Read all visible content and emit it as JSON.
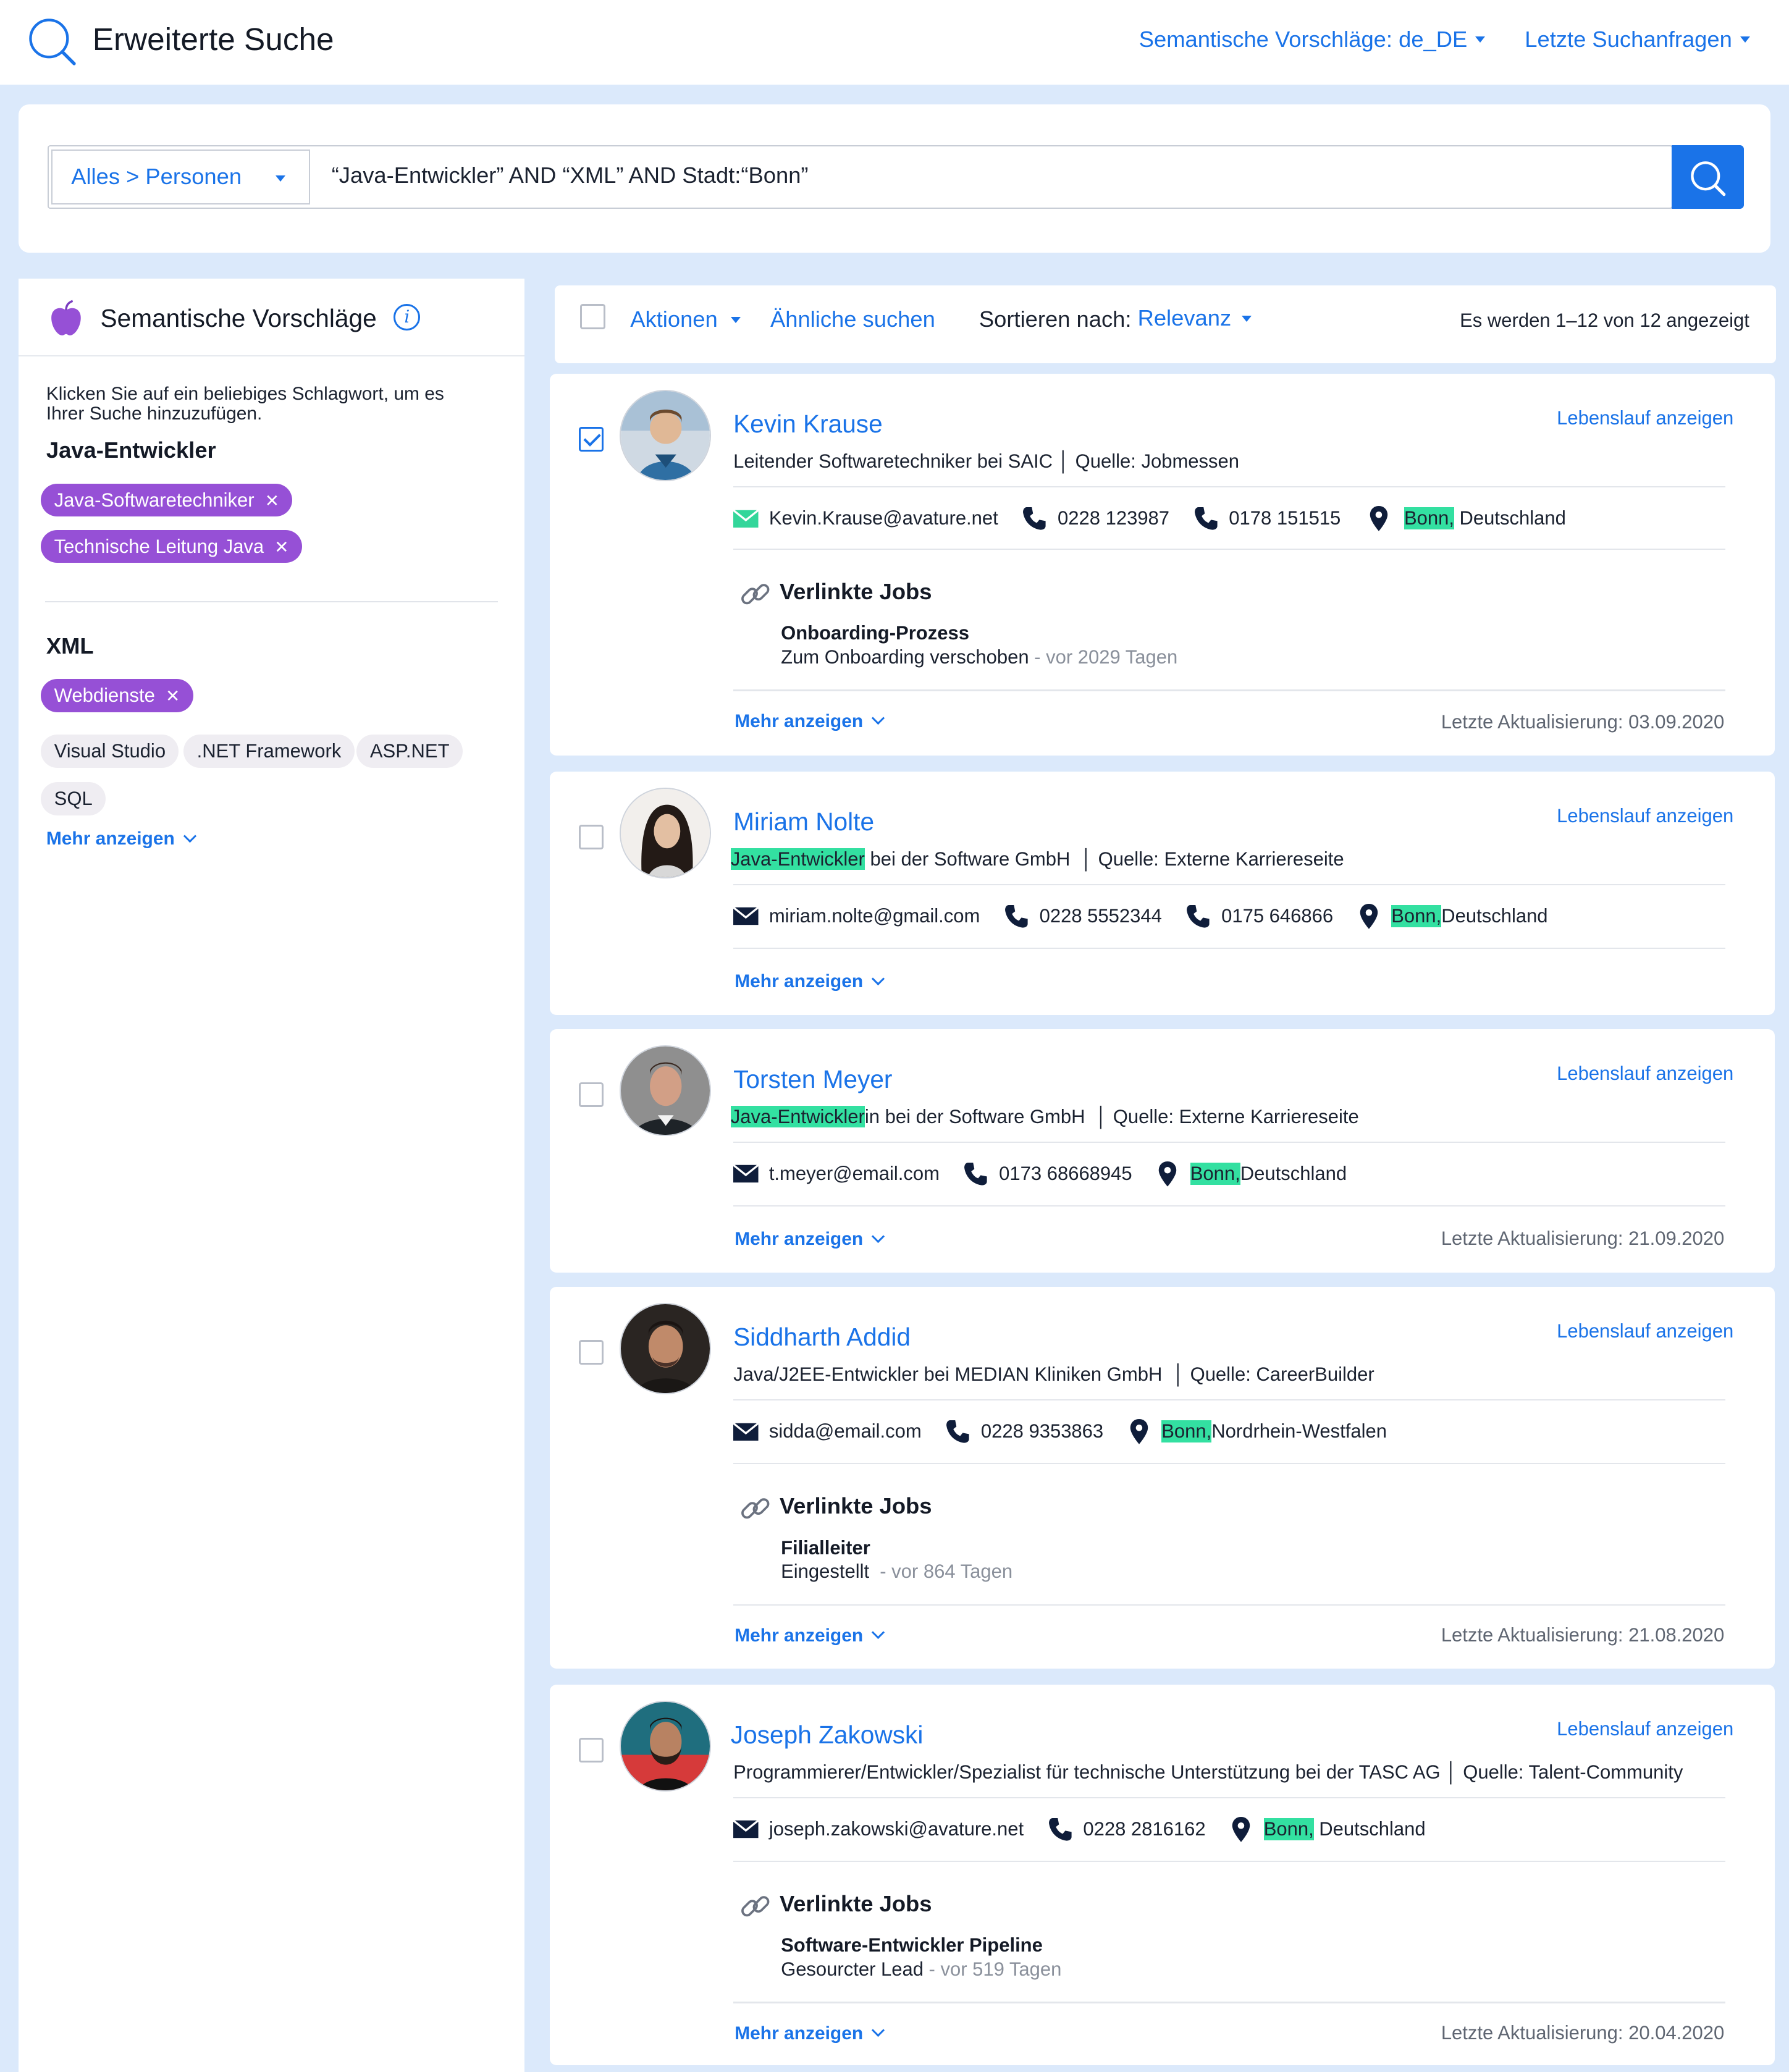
{
  "header": {
    "title": "Erweiterte Suche",
    "suggest_menu": "Semantische Vorschläge: de_DE",
    "recent_menu": "Letzte Suchanfragen"
  },
  "search": {
    "scope": "Alles > Personen",
    "query": "“Java-Entwickler” AND “XML” AND Stadt:“Bonn”"
  },
  "sidebar": {
    "title": "Semantische Vorschläge",
    "hint": "Klicken Sie auf ein beliebiges Schlagwort, um es Ihrer Suche hinzuzufügen.",
    "groups": [
      {
        "title": "Java-Entwickler",
        "selected": [
          "Java-Softwaretechniker",
          "Technische Leitung Java"
        ]
      },
      {
        "title": "XML",
        "selected": [
          "Webdienste"
        ],
        "suggestions": [
          "Visual Studio",
          ".NET Framework",
          "ASP.NET",
          "SQL"
        ]
      }
    ],
    "more": "Mehr anzeigen"
  },
  "toolbar": {
    "actions": "Aktionen",
    "similar": "Ähnliche suchen",
    "sort_label": "Sortieren nach:",
    "sort_value": "Relevanz",
    "count": "Es werden 1–12 von 12 angezeigt"
  },
  "common": {
    "cv_link": "Lebenslauf anzeigen",
    "more": "Mehr anzeigen",
    "linked_jobs": "Verlinkte Jobs"
  },
  "results": [
    {
      "name": "Kevin Krause",
      "checked": true,
      "headline": "Leitender Softwaretechniker bei SAIC",
      "source": "Quelle: Jobmessen",
      "email": "Kevin.Krause@avature.net",
      "phones": [
        "0228 123987",
        "0178 151515"
      ],
      "city": "Bonn,",
      "region": "Deutschland",
      "job": {
        "name": "Onboarding-Prozess",
        "status": "Zum Onboarding verschoben",
        "age": "- vor 2029 Tagen"
      },
      "updated": "Letzte Aktualisierung: 03.09.2020"
    },
    {
      "name": "Miriam Nolte",
      "checked": false,
      "headline_hl": "Java-Entwickler",
      "headline_rest": " bei der Software GmbH",
      "source": "Quelle: Externe Karriereseite",
      "email": "miriam.nolte@gmail.com",
      "phones": [
        "0228 5552344",
        "0175 646866"
      ],
      "city": "Bonn,",
      "region": "Deutschland"
    },
    {
      "name": "Torsten Meyer",
      "checked": false,
      "headline_hl": "Java-Entwickler",
      "headline_rest": "in bei der Software GmbH",
      "source": "Quelle: Externe Karriereseite",
      "email": "t.meyer@email.com",
      "phones": [
        "0173 68668945"
      ],
      "city": "Bonn,",
      "region": "Deutschland",
      "updated": "Letzte Aktualisierung: 21.09.2020"
    },
    {
      "name": "Siddharth Addid",
      "checked": false,
      "headline": "Java/J2EE-Entwickler bei MEDIAN Kliniken GmbH",
      "source": "Quelle: CareerBuilder",
      "email": "sidda@email.com",
      "phones": [
        "0228 9353863"
      ],
      "city": "Bonn,",
      "region": "Nordrhein-Westfalen",
      "job": {
        "name": "Filialleiter",
        "status": "Eingestellt",
        "age": "- vor 864 Tagen"
      },
      "updated": "Letzte Aktualisierung: 21.08.2020"
    },
    {
      "name": "Joseph Zakowski",
      "checked": false,
      "headline": "Programmierer/Entwickler/Spezialist für technische Unterstützung bei der TASC AG",
      "source": "Quelle: Talent-Community",
      "email": "joseph.zakowski@avature.net",
      "phones": [
        "0228 2816162"
      ],
      "city": "Bonn,",
      "region": "Deutschland",
      "job": {
        "name": "Software-Entwickler Pipeline",
        "status": "Gesourcter Lead",
        "age": "- vor 519 Tagen"
      },
      "updated": "Letzte Aktualisierung: 20.04.2020"
    }
  ],
  "colors": {
    "accent": "#1a73e8",
    "chip": "#9650d6",
    "highlight": "#33e0a1",
    "background": "#dbe9fb"
  }
}
